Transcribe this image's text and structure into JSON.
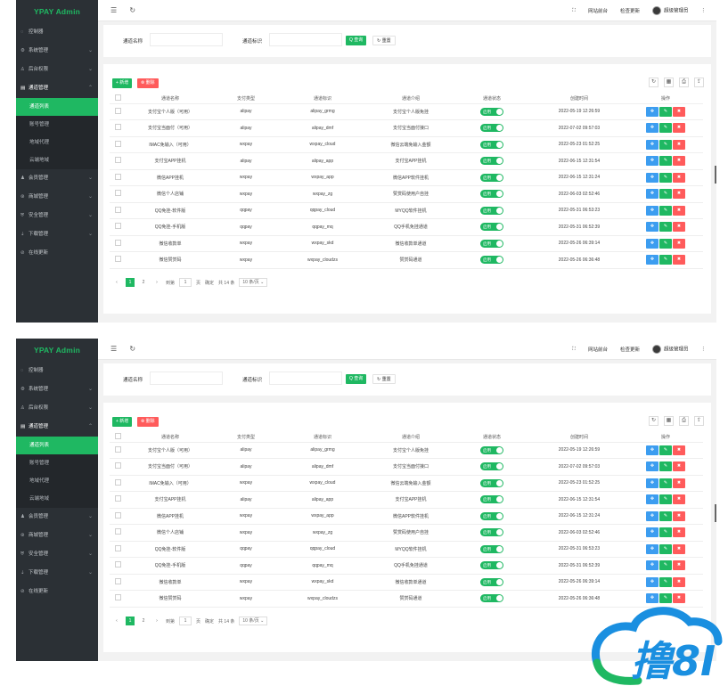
{
  "app": {
    "logo": "YPAY Admin",
    "sidebar": [
      {
        "label": "控制器",
        "icon": "dashboard-icon",
        "has_children": false
      },
      {
        "label": "系统管理",
        "icon": "gear-icon",
        "has_children": true
      },
      {
        "label": "后台权限",
        "icon": "user-icon",
        "has_children": true
      },
      {
        "label": "通道管理",
        "icon": "channel-icon",
        "has_children": true,
        "open": true,
        "children": [
          {
            "label": "通道列表",
            "active": true
          },
          {
            "label": "账号管理"
          },
          {
            "label": "地域代理"
          },
          {
            "label": "云端地域"
          }
        ]
      },
      {
        "label": "会员管理",
        "icon": "member-icon",
        "has_children": true
      },
      {
        "label": "商城管理",
        "icon": "shop-icon",
        "has_children": true
      },
      {
        "label": "安全管理",
        "icon": "shield-icon",
        "has_children": true
      },
      {
        "label": "下载管理",
        "icon": "download-icon",
        "has_children": true
      },
      {
        "label": "在线更新",
        "icon": "update-icon",
        "has_children": false
      }
    ],
    "topbar": {
      "menu_icon": "☰",
      "refresh_icon": "↻",
      "fullscreen_icon": "⛶",
      "site_link": "网站前台",
      "update_link": "检查更新",
      "user_name": "超级管理员",
      "more_icon": "⋮"
    },
    "search": {
      "name_label": "通道名称",
      "id_label": "通道标识",
      "search_button": "Q 查询",
      "reset_button": "↻ 重置"
    },
    "toolbar": {
      "add_button": "+ 新增",
      "delete_button": "⊗ 删除",
      "tools": [
        "↻",
        "▦",
        "⎙",
        "⇪"
      ]
    },
    "table": {
      "columns": [
        "通道名称",
        "支付类型",
        "通道标识",
        "通道介绍",
        "通道状态",
        "创建时间",
        "操作"
      ],
      "rows": [
        {
          "name": "支付宝个人版（可用）",
          "type": "alipay",
          "id": "alipay_grmg",
          "desc": "支付宝个人版免挂",
          "status": "启用",
          "time": "2022-05-19 12:26:59"
        },
        {
          "name": "支付宝当面付（可用）",
          "type": "alipay",
          "id": "alipay_dmf",
          "desc": "支付宝当面付接口",
          "status": "启用",
          "time": "2022-07-02 09:57:03"
        },
        {
          "name": "IMAC免输入（可用）",
          "type": "wxpay",
          "id": "wxpay_cloud",
          "desc": "微信云端免输入金额",
          "status": "启用",
          "time": "2022-05-23 01:52:25"
        },
        {
          "name": "支付宝APP挂机",
          "type": "alipay",
          "id": "alipay_app",
          "desc": "支付宝APP挂机",
          "status": "启用",
          "time": "2022-06-15 12:31:54"
        },
        {
          "name": "微信APP挂机",
          "type": "wxpay",
          "id": "wxpay_app",
          "desc": "微信APP软件挂机",
          "status": "启用",
          "time": "2022-06-15 12:31:24"
        },
        {
          "name": "微信个人店铺",
          "type": "wxpay",
          "id": "wxpay_zg",
          "desc": "赞赏码使用户自挂",
          "status": "启用",
          "time": "2022-06-03 02:52:46"
        },
        {
          "name": "QQ免挂-软件版",
          "type": "qqpay",
          "id": "qqpay_cloud",
          "desc": "MYQQ软件挂机",
          "status": "启用",
          "time": "2022-05-31 06:53:23"
        },
        {
          "name": "QQ免挂-手机版",
          "type": "qqpay",
          "id": "qqpay_mq",
          "desc": "QQ手机免挂通道",
          "status": "启用",
          "time": "2022-05-31 06:52:39"
        },
        {
          "name": "微信收款单",
          "type": "wxpay",
          "id": "wxpay_skd",
          "desc": "微信收款单通道",
          "status": "启用",
          "time": "2022-05-26 06:39:14"
        },
        {
          "name": "微信赞赏码",
          "type": "wxpay",
          "id": "wxpay_cloudzs",
          "desc": "赞赏码通道",
          "status": "启用",
          "time": "2022-05-26 06:36:48"
        }
      ],
      "op_icons": [
        "✥",
        "✎",
        "✖"
      ]
    },
    "pager": {
      "prev": "‹",
      "pages": [
        "1",
        "2"
      ],
      "next": "›",
      "goto_label": "到第",
      "goto_value": "1",
      "page_unit": "页",
      "confirm": "确定",
      "total": "共 14 条",
      "page_size": "10 条/页 ⌄"
    }
  },
  "colors": {
    "sidebar_bg": "#2b3035",
    "accent": "#1fb862",
    "danger": "#ff5b5b",
    "info": "#3c9df0"
  },
  "watermark": {
    "text": "撸8I"
  }
}
